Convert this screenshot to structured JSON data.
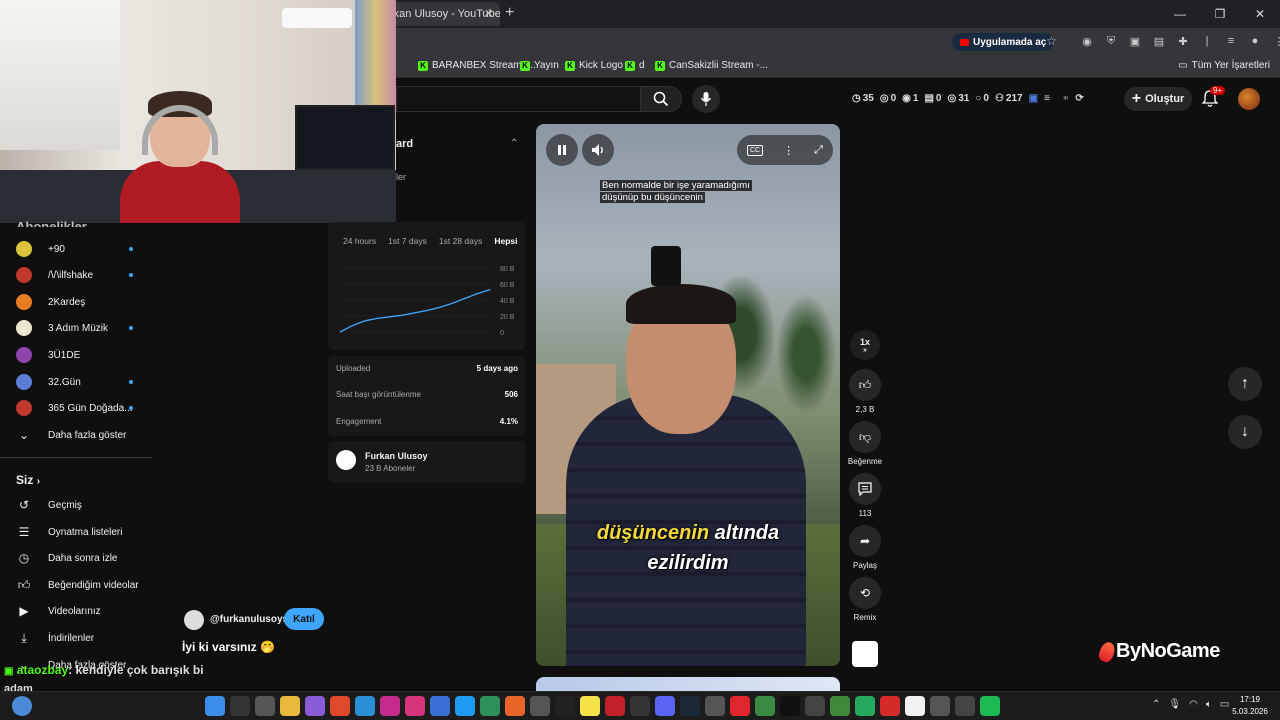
{
  "browser": {
    "tab_title": "rkan Ulusoy - YouTube",
    "open_in_app": "Uygulamada aç",
    "bookmarks": [
      "BARANBEX Stream -...",
      "Yayın",
      "Kick Logo",
      "d",
      "CanSakizlii Stream -..."
    ],
    "all_bookmarks": "Tüm Yer İşaretleri"
  },
  "header": {
    "stats": [
      "35",
      "0",
      "1",
      "0",
      "31",
      "0",
      "217"
    ],
    "create_label": "Oluştur",
    "notif_badge": "9+"
  },
  "sidebar": {
    "subs_header": "Abonelikler",
    "subscriptions": [
      {
        "name": "+90",
        "color": "#d8c33a",
        "dot": true
      },
      {
        "name": "/\\/\\ilfshake",
        "color": "#c0392b",
        "dot": true
      },
      {
        "name": "2Kardeş",
        "color": "#e67e22",
        "dot": false
      },
      {
        "name": "3 Adım Müzik",
        "color": "#f0e6d2",
        "dot": true
      },
      {
        "name": "3Ü1DE",
        "color": "#8e44ad",
        "dot": false
      },
      {
        "name": "32.Gün",
        "color": "#5b7fd6",
        "dot": true
      },
      {
        "name": "365 Gün Doğada...",
        "color": "#c0392b",
        "dot": true
      }
    ],
    "show_more": "Daha fazla göster",
    "you_section": "Siz",
    "you_items": [
      "Geçmiş",
      "Oynatma listeleri",
      "Daha sonra izle",
      "Beğendiğim videolar",
      "Videolarınız",
      "İndirilenler",
      "Daha fazla göster"
    ]
  },
  "panel": {
    "title": "ard",
    "subtitle": "ler",
    "ranges": [
      "24 hours",
      "1st 7 days",
      "1st 28 days",
      "Hepsi"
    ],
    "active_range": "Hepsi",
    "uploaded_label": "Uploaded",
    "uploaded_value": "5 days ago",
    "hourly_label": "Saat başı görüntülenme",
    "hourly_value": "506",
    "engagement_label": "Engagement",
    "engagement_value": "4.1%",
    "channel_name": "Furkan Ulusoy",
    "channel_subs": "23 B Aboneler"
  },
  "chart_data": {
    "type": "line",
    "yticks": [
      "80 B",
      "60 B",
      "40 B",
      "20 B",
      "0"
    ],
    "ylim": [
      0,
      80
    ],
    "x": [
      0,
      1,
      2,
      3,
      4,
      5,
      6,
      7,
      8,
      9,
      10,
      11,
      12
    ],
    "values": [
      0,
      8,
      14,
      17,
      19,
      21,
      24,
      27,
      31,
      36,
      42,
      48,
      53
    ],
    "color": "#3ea6ff",
    "xlabel": "",
    "ylabel": ""
  },
  "video": {
    "caption_top_line1": "Ben normalde bir işe yaramadığımı",
    "caption_top_line2": "düşünüp bu düşüncenin",
    "caption_main_highlight": "düşüncenin",
    "caption_main_rest": " altında",
    "caption_main_line2": "ezilirdim"
  },
  "actions": {
    "speed": "1x",
    "likes": "2,3 B",
    "dislike_label": "Beğenme",
    "comments": "113",
    "share_label": "Paylaş",
    "remix_label": "Remix"
  },
  "overlay": {
    "watermark": "ByNoGame",
    "chat_handle": "@furkanulusoys",
    "join_label": "Katıl",
    "chat_message": "İyi ki varsınız 🤭",
    "live_user": "ataozbay",
    "live_text": ": kendiyle çok barışık bi",
    "live_text2": "adam"
  },
  "taskbar": {
    "time": "17:19",
    "date": "5.03.2026"
  }
}
